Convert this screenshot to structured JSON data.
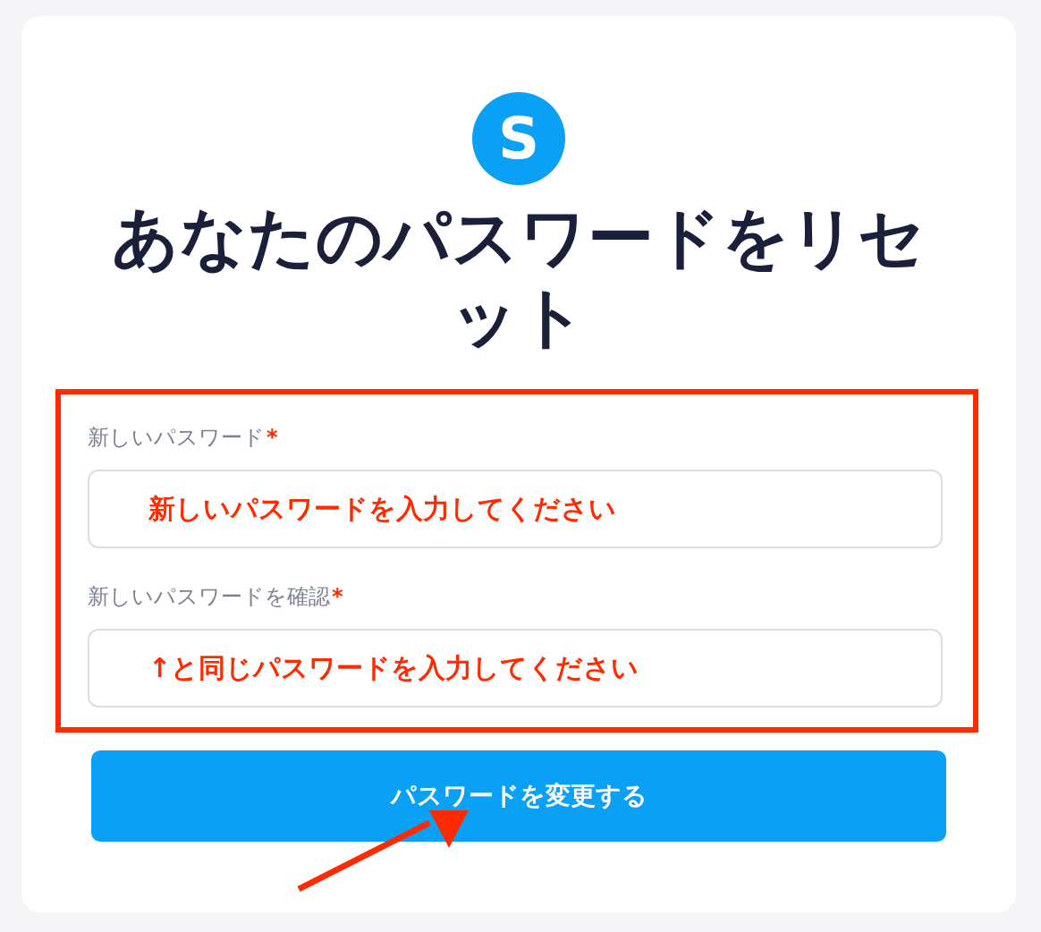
{
  "logo": {
    "letter": "S"
  },
  "title": "あなたのパスワードをリセット",
  "fields": [
    {
      "label": "新しいパスワード",
      "required": true,
      "annotation": "新しいパスワードを入力してください"
    },
    {
      "label": "新しいパスワードを確認",
      "required": true,
      "annotation": "↑と同じパスワードを入力してください"
    }
  ],
  "required_mark": "*",
  "submit_button": "パスワードを変更する"
}
